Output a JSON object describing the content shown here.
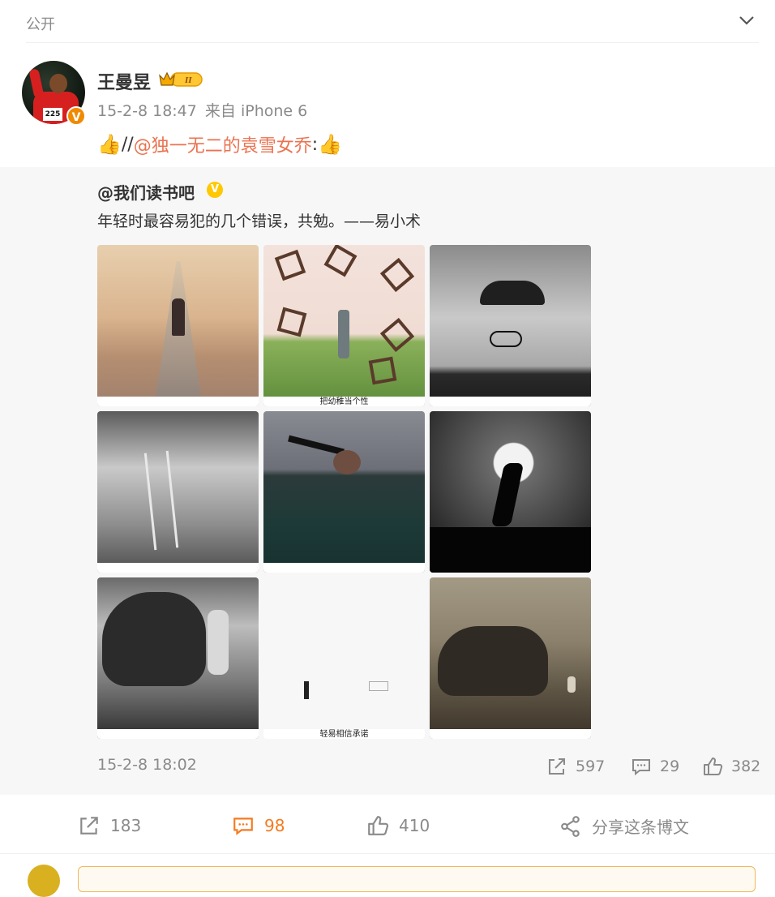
{
  "top": {
    "visibility": "公开"
  },
  "post": {
    "username": "王曼昱",
    "vip_badge": "II",
    "avatar_bib": "225",
    "time": "15-2-8 18:47",
    "source": "来自 iPhone 6",
    "text_prefix": "//",
    "mention": "@独一无二的袁雪女乔",
    "text_suffix": ":"
  },
  "repost": {
    "author": "@我们读书吧",
    "verified_badge": "V",
    "text": "年轻时最容易犯的几个错误，共勉。——易小术",
    "images": [
      {
        "caption": ""
      },
      {
        "caption": "把幼稚当个性"
      },
      {
        "caption": ""
      },
      {
        "caption": ""
      },
      {
        "caption": ""
      },
      {
        "caption": ""
      },
      {
        "caption": ""
      },
      {
        "caption": "轻易相信承诺"
      },
      {
        "caption": ""
      }
    ],
    "time": "15-2-8 18:02",
    "reposts": "597",
    "comments": "29",
    "likes": "382"
  },
  "actions": {
    "reposts": "183",
    "comments": "98",
    "likes": "410",
    "share": "分享这条博文"
  },
  "colors": {
    "accent": "#f57a20",
    "mention": "#eb7350",
    "meta": "#8a8a8a",
    "repost_bg": "#f7f7f7"
  }
}
